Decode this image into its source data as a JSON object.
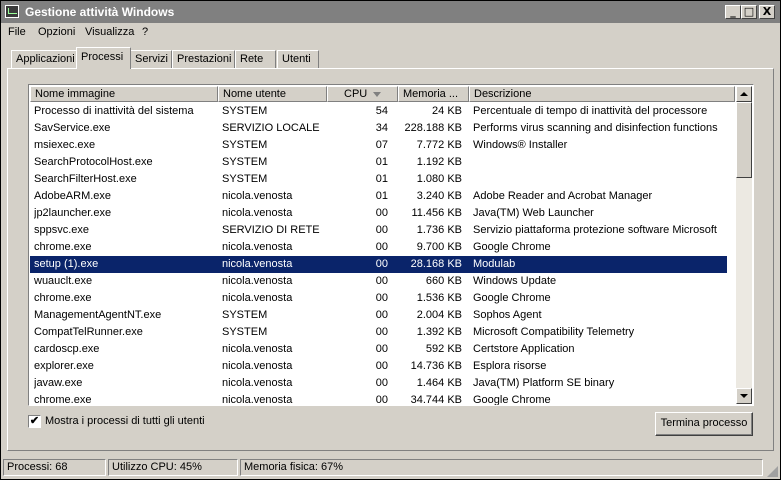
{
  "window": {
    "title": "Gestione attività Windows"
  },
  "title_buttons": {
    "minimize": "_",
    "restore": "□",
    "close": "X"
  },
  "menu": [
    "File",
    "Opzioni",
    "Visualizza",
    "?"
  ],
  "tabs": [
    {
      "label": "Applicazioni",
      "active": false
    },
    {
      "label": "Processi",
      "active": true
    },
    {
      "label": "Servizi",
      "active": false
    },
    {
      "label": "Prestazioni",
      "active": false
    },
    {
      "label": "Rete",
      "active": false
    },
    {
      "label": "Utenti",
      "active": false
    }
  ],
  "table": {
    "columns": [
      "Nome immagine",
      "Nome utente",
      "CPU",
      "Memoria ...",
      "Descrizione"
    ],
    "sort_column": "CPU",
    "rows": [
      {
        "image": "Processo di inattività del sistema",
        "user": "SYSTEM",
        "cpu": "54",
        "mem": "24 KB",
        "desc": "Percentuale di tempo di inattività del processore"
      },
      {
        "image": "SavService.exe",
        "user": "SERVIZIO LOCALE",
        "cpu": "34",
        "mem": "228.188 KB",
        "desc": "Performs virus scanning and disinfection functions"
      },
      {
        "image": "msiexec.exe",
        "user": "SYSTEM",
        "cpu": "07",
        "mem": "7.772 KB",
        "desc": "Windows® Installer"
      },
      {
        "image": "SearchProtocolHost.exe",
        "user": "SYSTEM",
        "cpu": "01",
        "mem": "1.192 KB",
        "desc": ""
      },
      {
        "image": "SearchFilterHost.exe",
        "user": "SYSTEM",
        "cpu": "01",
        "mem": "1.080 KB",
        "desc": ""
      },
      {
        "image": "AdobeARM.exe",
        "user": "nicola.venosta",
        "cpu": "01",
        "mem": "3.240 KB",
        "desc": "Adobe Reader and Acrobat Manager"
      },
      {
        "image": "jp2launcher.exe",
        "user": "nicola.venosta",
        "cpu": "00",
        "mem": "11.456 KB",
        "desc": "Java(TM) Web Launcher"
      },
      {
        "image": "sppsvc.exe",
        "user": "SERVIZIO DI RETE",
        "cpu": "00",
        "mem": "1.736 KB",
        "desc": "Servizio piattaforma protezione software Microsoft"
      },
      {
        "image": "chrome.exe",
        "user": "nicola.venosta",
        "cpu": "00",
        "mem": "9.700 KB",
        "desc": "Google Chrome"
      },
      {
        "image": "setup (1).exe",
        "user": "nicola.venosta",
        "cpu": "00",
        "mem": "28.168 KB",
        "desc": "Modulab",
        "selected": true
      },
      {
        "image": "wuauclt.exe",
        "user": "nicola.venosta",
        "cpu": "00",
        "mem": "660 KB",
        "desc": "Windows Update"
      },
      {
        "image": "chrome.exe",
        "user": "nicola.venosta",
        "cpu": "00",
        "mem": "1.536 KB",
        "desc": "Google Chrome"
      },
      {
        "image": "ManagementAgentNT.exe",
        "user": "SYSTEM",
        "cpu": "00",
        "mem": "2.004 KB",
        "desc": "Sophos Agent"
      },
      {
        "image": "CompatTelRunner.exe",
        "user": "SYSTEM",
        "cpu": "00",
        "mem": "1.392 KB",
        "desc": "Microsoft Compatibility Telemetry"
      },
      {
        "image": "cardoscp.exe",
        "user": "nicola.venosta",
        "cpu": "00",
        "mem": "592 KB",
        "desc": "Certstore Application"
      },
      {
        "image": "explorer.exe",
        "user": "nicola.venosta",
        "cpu": "00",
        "mem": "14.736 KB",
        "desc": "Esplora risorse"
      },
      {
        "image": "javaw.exe",
        "user": "nicola.venosta",
        "cpu": "00",
        "mem": "1.464 KB",
        "desc": "Java(TM) Platform SE binary"
      },
      {
        "image": "chrome.exe",
        "user": "nicola.venosta",
        "cpu": "00",
        "mem": "34.744 KB",
        "desc": "Google Chrome"
      }
    ]
  },
  "show_all_checkbox": {
    "label": "Mostra i processi di tutti gli utenti",
    "checked": true,
    "check_glyph": "✔"
  },
  "end_process_button": "Termina processo",
  "status": {
    "processes": "Processi: 68",
    "cpu": "Utilizzo CPU: 45%",
    "memory": "Memoria fisica: 67%"
  },
  "colors": {
    "selection": "#0a246a",
    "titlebar_inactive": "#808080",
    "face": "#d4d0c8"
  }
}
